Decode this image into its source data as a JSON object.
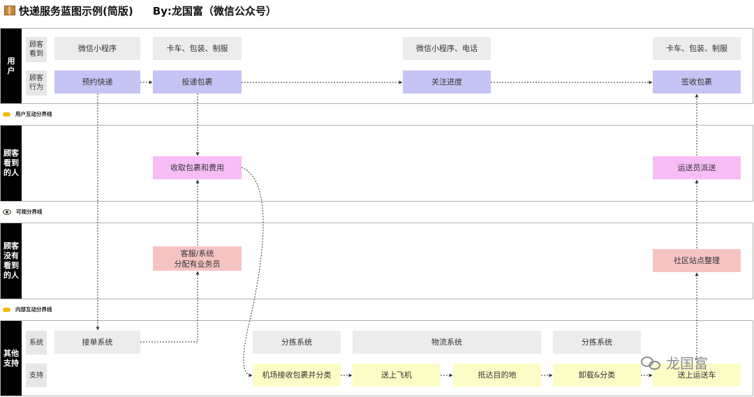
{
  "title": "快递服务蓝图示例(简版)",
  "author": "By:龙国富（微信公众号）",
  "lanes": {
    "user": "用\n户",
    "seen": "顾客\n看到\n的人",
    "unseen": "顾客\n没有\n看到\n的人",
    "other": "其他\n支持"
  },
  "row_labels": {
    "customer_sees": "顾客\n看到",
    "customer_action": "顾客\n行为",
    "system": "系统",
    "support": "支持"
  },
  "dividers": {
    "interaction": "用户互动分界线",
    "visibility": "可视分界线",
    "internal": "内部互动分界线"
  },
  "touchpoints": [
    "微信小程序",
    "卡车、包装、制服",
    "微信小程序、电话",
    "卡车、包装、制服"
  ],
  "actions": [
    "预约快递",
    "投递包裹",
    "关注进度",
    "签收包裹"
  ],
  "frontstage": [
    "收取包裹和费用",
    "运送员派送"
  ],
  "backstage": [
    "客服/系统\n分配有业务员",
    "社区站点整理"
  ],
  "systems": [
    "接单系统",
    "分拣系统",
    "物流系统",
    "分拣系统"
  ],
  "support": [
    "机场接收包裹并分类",
    "送上飞机",
    "抵达目的地",
    "卸载&分类",
    "送上运送车"
  ],
  "watermark": "龙国富",
  "colors": {
    "lane_header": "#000000",
    "row_label": "#e7e7e7",
    "touchpoint": "#ececec",
    "action": "#c6c4f4",
    "frontstage": "#f7bdf7",
    "backstage": "#f6c3c3",
    "support": "#fcfcc6"
  }
}
